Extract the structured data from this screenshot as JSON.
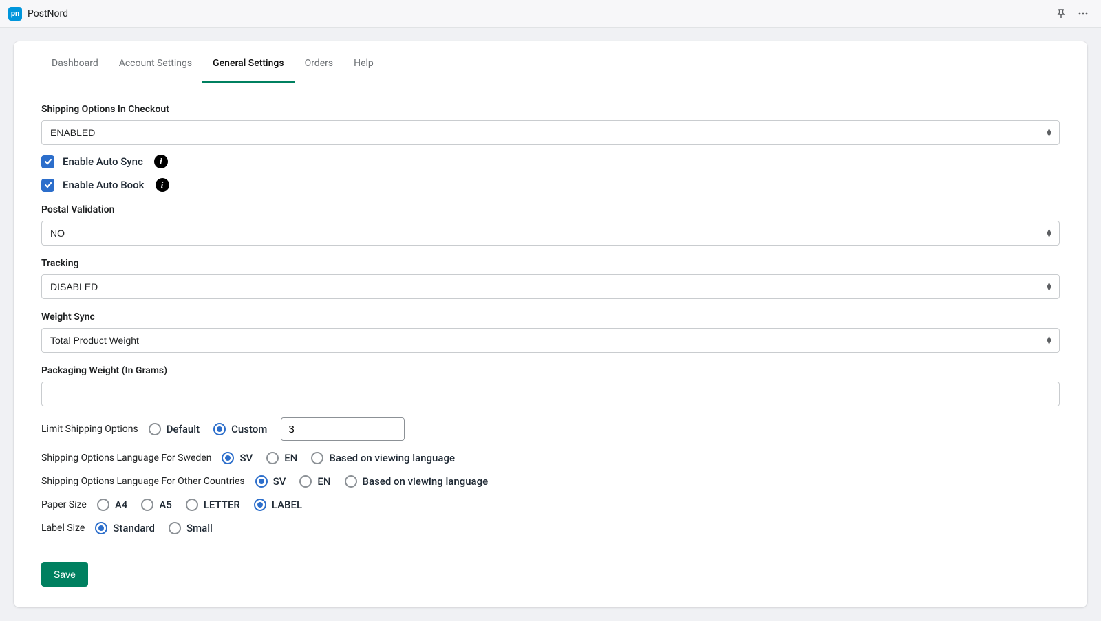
{
  "app": {
    "logo_text": "pn",
    "title": "PostNord"
  },
  "tabs": {
    "dashboard": "Dashboard",
    "account": "Account Settings",
    "general": "General Settings",
    "orders": "Orders",
    "help": "Help"
  },
  "labels": {
    "shipping_options_checkout": "Shipping Options In Checkout",
    "enable_auto_sync": "Enable Auto Sync",
    "enable_auto_book": "Enable Auto Book",
    "postal_validation": "Postal Validation",
    "tracking": "Tracking",
    "weight_sync": "Weight Sync",
    "packaging_weight": "Packaging Weight (In Grams)",
    "limit_shipping": "Limit Shipping Options",
    "lang_sweden": "Shipping Options Language For Sweden",
    "lang_other": "Shipping Options Language For Other Countries",
    "paper_size": "Paper Size",
    "label_size": "Label Size"
  },
  "values": {
    "shipping_options_checkout": "ENABLED",
    "postal_validation": "NO",
    "tracking": "DISABLED",
    "weight_sync": "Total Product Weight",
    "packaging_weight": "",
    "limit_number": "3"
  },
  "options": {
    "limit": {
      "default": "Default",
      "custom": "Custom"
    },
    "lang": {
      "sv": "SV",
      "en": "EN",
      "viewing": "Based on viewing language"
    },
    "paper": {
      "a4": "A4",
      "a5": "A5",
      "letter": "LETTER",
      "label": "LABEL"
    },
    "labelsize": {
      "standard": "Standard",
      "small": "Small"
    }
  },
  "buttons": {
    "save": "Save"
  }
}
